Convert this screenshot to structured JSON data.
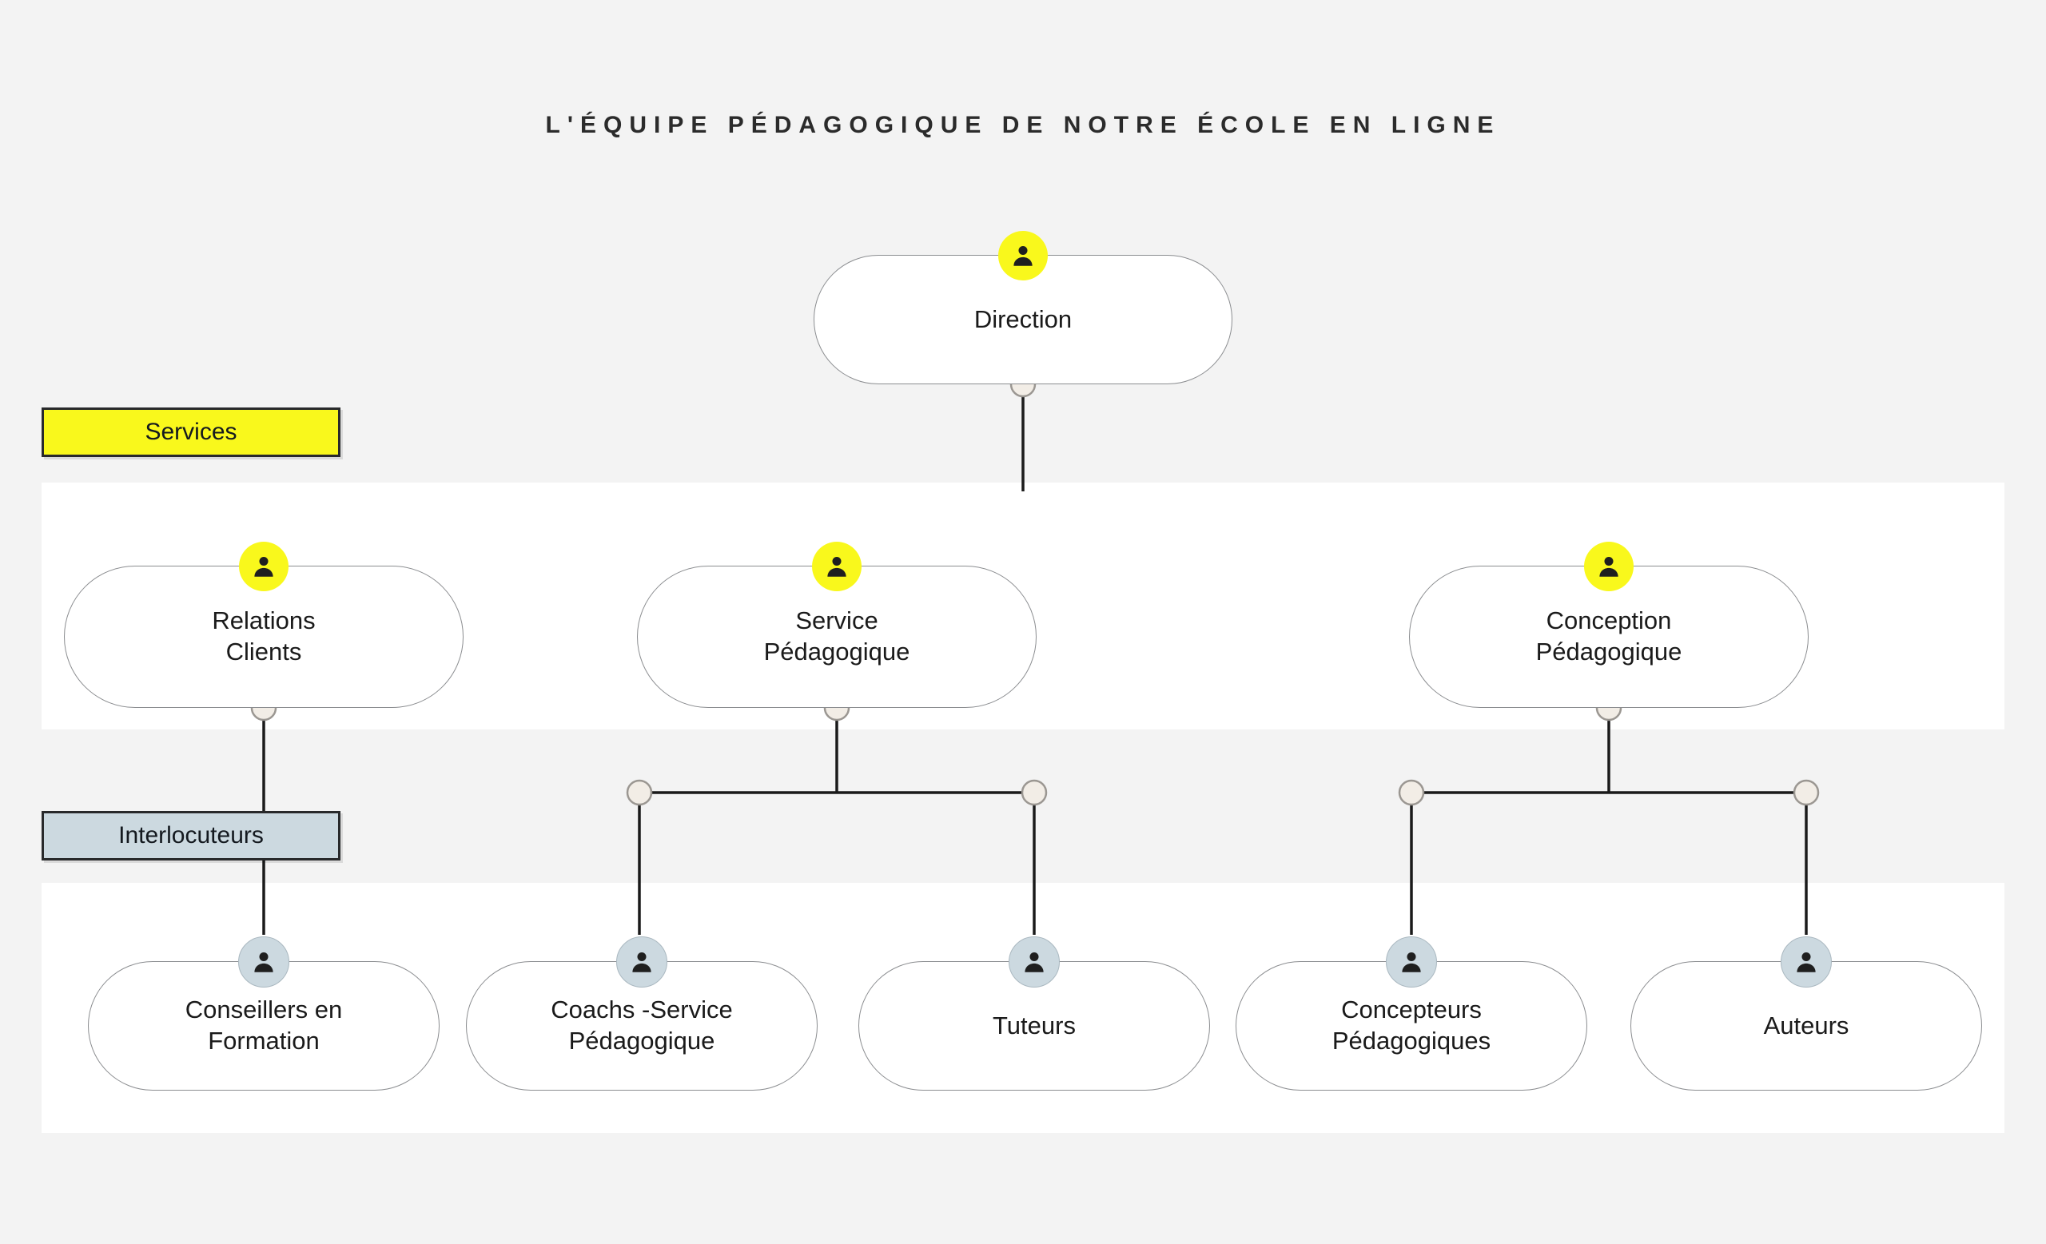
{
  "title": "L'ÉQUIPE PÉDAGOGIQUE DE NOTRE ÉCOLE EN LIGNE",
  "colors": {
    "page_background": "#f3f3f3",
    "band_background": "#ffffff",
    "services_tag": "#f9f81c",
    "interlocuteurs_tag": "#ccd9e0",
    "node_fill": "#ffffff",
    "node_border": "#8b8d90",
    "connector_line": "#1a1a1a",
    "connector_dot": "#f2ede6",
    "icon_person": "#1f1f1f"
  },
  "tags": [
    {
      "id": "services",
      "label": "Services"
    },
    {
      "id": "interlocuteurs",
      "label": "Interlocuteurs"
    }
  ],
  "levels": {
    "direction": {
      "nodes": [
        {
          "id": "direction",
          "lines": [
            "Direction"
          ],
          "icon": "person-icon",
          "icon_color": "yellow"
        }
      ]
    },
    "services": {
      "nodes": [
        {
          "id": "relations-clients",
          "lines": [
            "Relations",
            "Clients"
          ],
          "icon": "person-icon",
          "icon_color": "yellow"
        },
        {
          "id": "service-pedagogique",
          "lines": [
            "Service",
            "Pédagogique"
          ],
          "icon": "person-icon",
          "icon_color": "yellow"
        },
        {
          "id": "conception-pedagogique",
          "lines": [
            "Conception",
            "Pédagogique"
          ],
          "icon": "person-icon",
          "icon_color": "yellow"
        }
      ]
    },
    "interlocuteurs": {
      "nodes": [
        {
          "id": "conseillers-en-formation",
          "lines": [
            "Conseillers en",
            "Formation"
          ],
          "icon": "person-icon",
          "icon_color": "blue"
        },
        {
          "id": "coachs-service-pedagogique",
          "lines": [
            "Coachs -Service",
            "Pédagogique"
          ],
          "icon": "person-icon",
          "icon_color": "blue"
        },
        {
          "id": "tuteurs",
          "lines": [
            "Tuteurs"
          ],
          "icon": "person-icon",
          "icon_color": "blue"
        },
        {
          "id": "concepteurs-pedagogiques",
          "lines": [
            "Concepteurs",
            "Pédagogiques"
          ],
          "icon": "person-icon",
          "icon_color": "blue"
        },
        {
          "id": "auteurs",
          "lines": [
            "Auteurs"
          ],
          "icon": "person-icon",
          "icon_color": "blue"
        }
      ]
    }
  },
  "edges": [
    {
      "from": "direction",
      "to": "relations-clients"
    },
    {
      "from": "direction",
      "to": "service-pedagogique"
    },
    {
      "from": "direction",
      "to": "conception-pedagogique"
    },
    {
      "from": "relations-clients",
      "to": "conseillers-en-formation"
    },
    {
      "from": "service-pedagogique",
      "to": "coachs-service-pedagogique"
    },
    {
      "from": "service-pedagogique",
      "to": "tuteurs"
    },
    {
      "from": "conception-pedagogique",
      "to": "concepteurs-pedagogiques"
    },
    {
      "from": "conception-pedagogique",
      "to": "auteurs"
    }
  ]
}
